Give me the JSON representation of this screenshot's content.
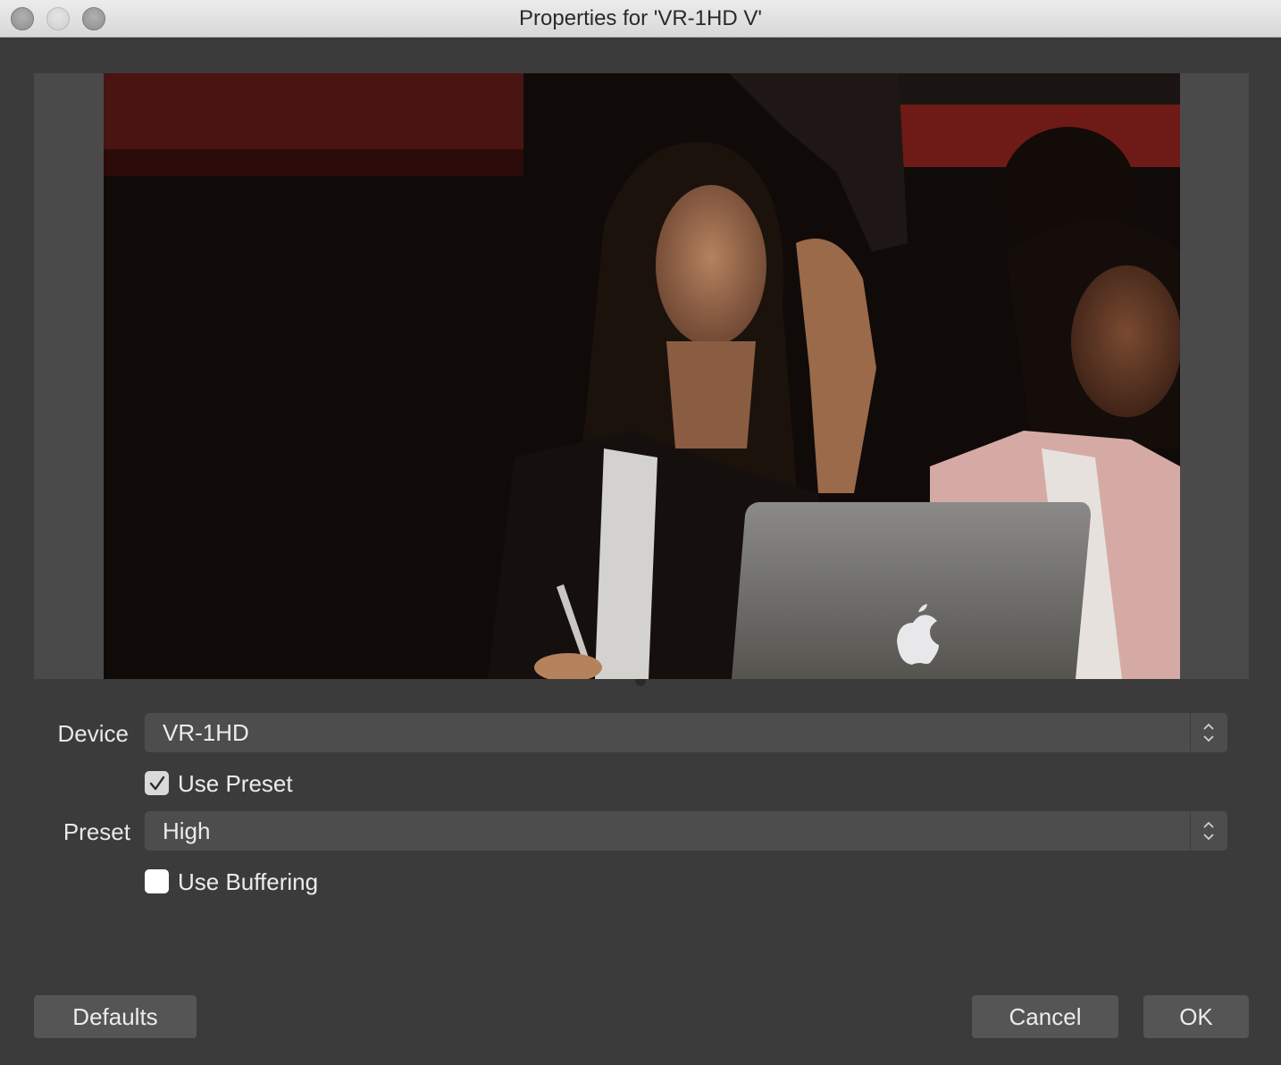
{
  "window": {
    "title": "Properties for 'VR-1HD V'"
  },
  "preview": {
    "description_icon": "camera-preview"
  },
  "form": {
    "device_label": "Device",
    "device_value": "VR-1HD",
    "use_preset_label": "Use Preset",
    "use_preset_checked": true,
    "preset_label": "Preset",
    "preset_value": "High",
    "use_buffering_label": "Use Buffering",
    "use_buffering_checked": false
  },
  "buttons": {
    "defaults": "Defaults",
    "cancel": "Cancel",
    "ok": "OK"
  }
}
